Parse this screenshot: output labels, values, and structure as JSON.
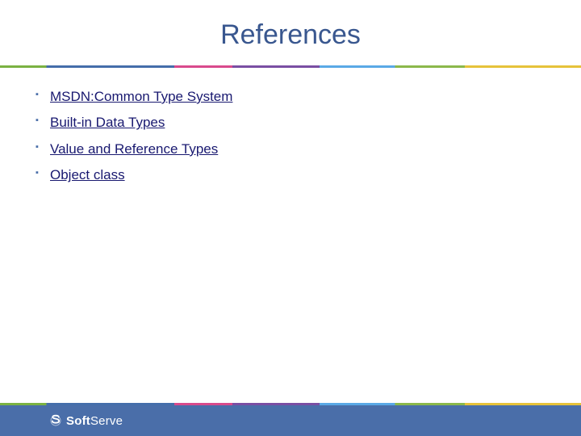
{
  "title": "References",
  "references": [
    {
      "label": "MSDN:Common Type System"
    },
    {
      "label": "Built-in Data Types"
    },
    {
      "label": "Value and Reference Types"
    },
    {
      "label": "Object class"
    }
  ],
  "footer": {
    "brand_prefix": "Soft",
    "brand_suffix": "Serve"
  }
}
